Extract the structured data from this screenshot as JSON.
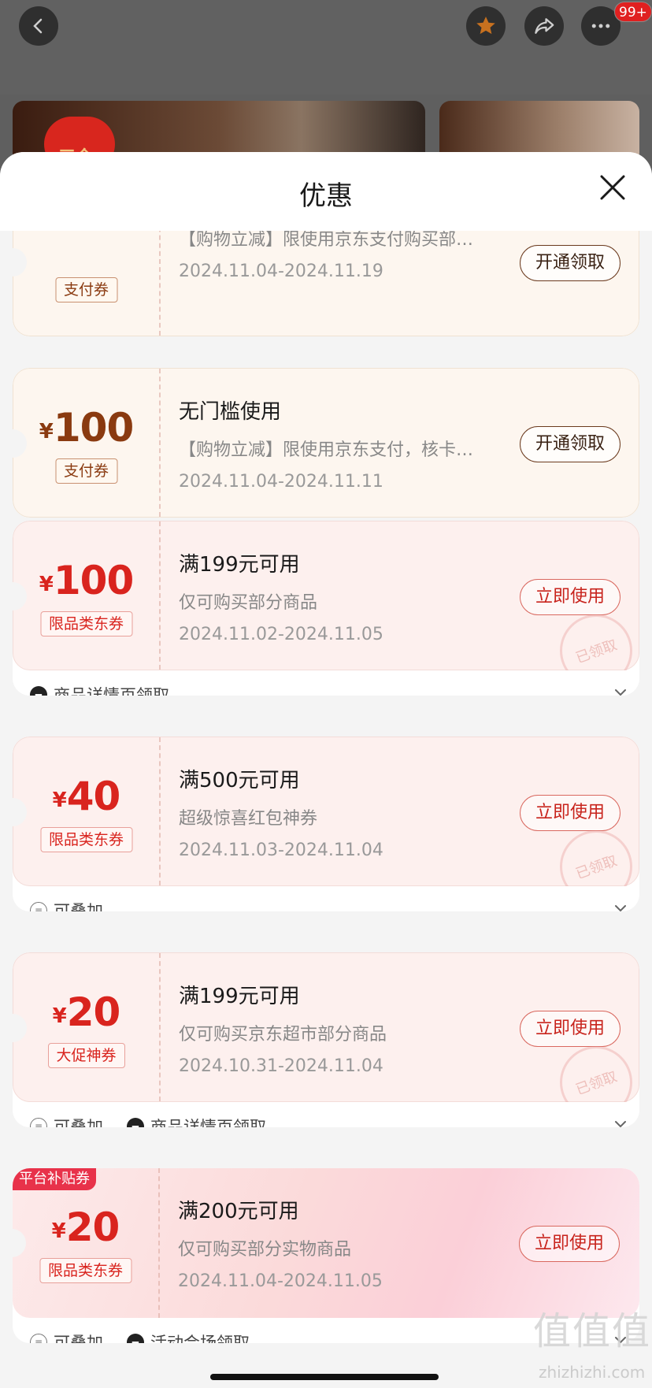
{
  "topbar": {
    "more_badge": "99+",
    "banner_logo_text": "三全"
  },
  "sheet": {
    "title": "优惠"
  },
  "coupons": [
    {
      "yen": "¥",
      "amount": "",
      "tag": "支付券",
      "condition": "",
      "desc": "【购物立减】限使用京东支付购买部…",
      "validity": "2024.11.04-2024.11.19",
      "action": "开通领取"
    },
    {
      "yen": "¥",
      "amount": "100",
      "tag": "支付券",
      "condition": "无门槛使用",
      "desc": "【购物立减】限使用京东支付，核卡…",
      "validity": "2024.11.04-2024.11.11",
      "action": "开通领取"
    },
    {
      "yen": "¥",
      "amount": "100",
      "tag": "限品类东券",
      "condition": "满199元可用",
      "desc": "仅可购买部分商品",
      "validity": "2024.11.02-2024.11.05",
      "action": "立即使用",
      "stamp": "已领取",
      "footer": [
        {
          "icon": "ticket-icon",
          "text": "商品详情页领取"
        }
      ]
    },
    {
      "yen": "¥",
      "amount": "40",
      "tag": "限品类东券",
      "condition": "满500元可用",
      "desc": "超级惊喜红包神券",
      "validity": "2024.11.03-2024.11.04",
      "action": "立即使用",
      "stamp": "已领取",
      "footer": [
        {
          "icon": "stack-icon",
          "text": "可叠加"
        }
      ]
    },
    {
      "yen": "¥",
      "amount": "20",
      "tag": "大促神券",
      "condition": "满199元可用",
      "desc": "仅可购买京东超市部分商品",
      "validity": "2024.10.31-2024.11.04",
      "action": "立即使用",
      "stamp": "已领取",
      "footer": [
        {
          "icon": "stack-icon",
          "text": "可叠加"
        },
        {
          "icon": "ticket-icon",
          "text": "商品详情页领取"
        }
      ]
    },
    {
      "badge": "平台补贴券",
      "yen": "¥",
      "amount": "20",
      "tag": "限品类东券",
      "condition": "满200元可用",
      "desc": "仅可购买部分实物商品",
      "validity": "2024.11.04-2024.11.05",
      "action": "立即使用",
      "footer": [
        {
          "icon": "stack-icon",
          "text": "可叠加"
        },
        {
          "icon": "ticket-icon",
          "text": "活动会场领取"
        }
      ]
    }
  ],
  "watermark": {
    "logo": "值值值",
    "url": "zhizhizhi.com"
  },
  "colors": {
    "accent_red": "#d9241e",
    "pay_brown": "#8a3a10",
    "platform_badge": "#e8324a"
  }
}
